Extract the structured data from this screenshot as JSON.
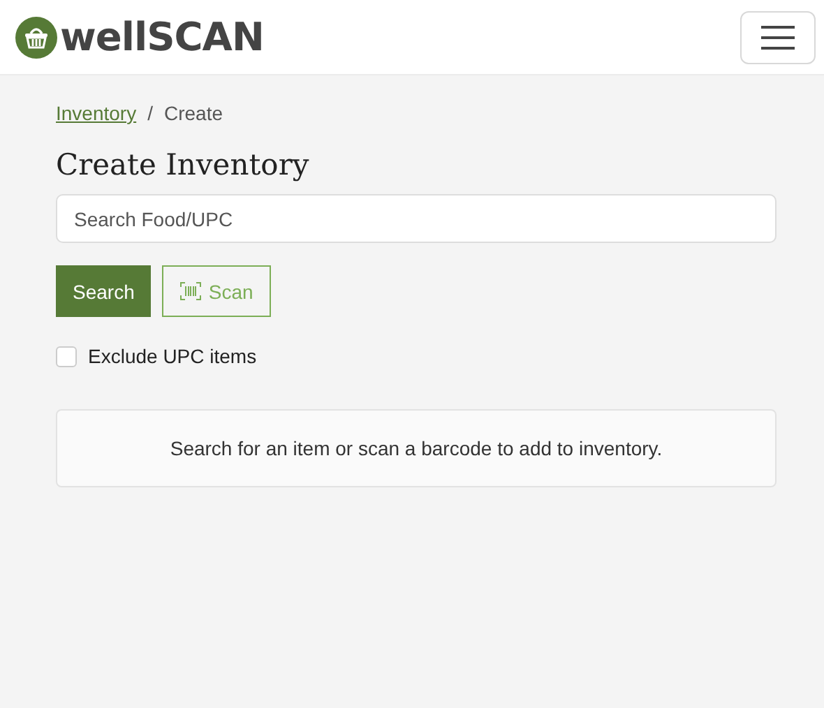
{
  "logo": "well**SCAN**",
  "breadcrumb": [
    {
      "label": "Inventory",
      "kind": "link"
    },
    {
      "label": "Create",
      "kind": "current"
    }
  ],
  "breadcrumb_separator": "/",
  "title": "Create Inventory",
  "search": {
    "placeholder": "Search Food/UPC"
  },
  "buttons": [
    {
      "label": "Search",
      "kind": "primary"
    },
    {
      "label": "Scan",
      "kind": "scan"
    }
  ],
  "exclude_upc": {
    "label": "Exclude UPC items",
    "checked": false
  },
  "message": "Search for an item or scan a barcode to add to inventory."
}
